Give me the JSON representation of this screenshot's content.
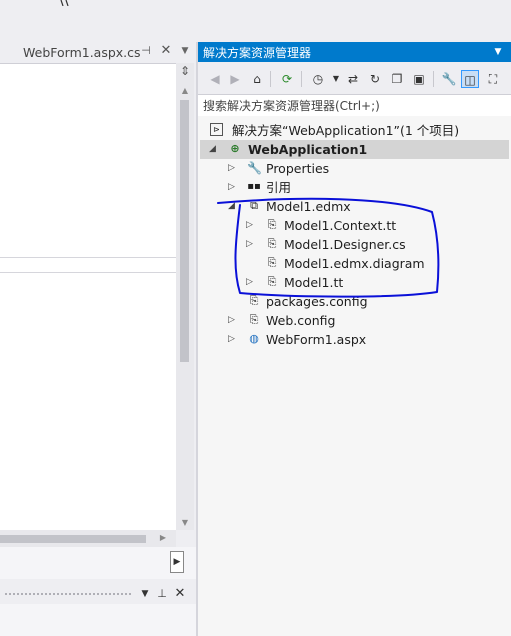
{
  "editor": {
    "tab_label": "WebForm1.aspx.cs",
    "close_glyph": "✕"
  },
  "solution_explorer": {
    "title": "解决方案资源管理器",
    "search_placeholder": "搜索解决方案资源管理器(Ctrl+;)",
    "tree": [
      {
        "label": "解决方案“WebApplication1”(1 个项目)",
        "icon": "solution-icon"
      },
      {
        "label": "WebApplication1",
        "icon": "web-project-icon",
        "bold": true,
        "selected": true
      },
      {
        "label": "Properties",
        "icon": "wrench-icon"
      },
      {
        "label": "引用",
        "icon": "references-icon"
      },
      {
        "label": "Model1.edmx",
        "icon": "edmx-icon"
      },
      {
        "label": "Model1.Context.tt",
        "icon": "tt-file-icon"
      },
      {
        "label": "Model1.Designer.cs",
        "icon": "cs-file-icon"
      },
      {
        "label": "Model1.edmx.diagram",
        "icon": "diagram-file-icon"
      },
      {
        "label": "Model1.tt",
        "icon": "tt-file-icon"
      },
      {
        "label": "packages.config",
        "icon": "config-file-icon"
      },
      {
        "label": "Web.config",
        "icon": "config-file-icon"
      },
      {
        "label": "WebForm1.aspx",
        "icon": "aspx-globe-icon"
      }
    ]
  },
  "colors": {
    "accent": "#007acc",
    "annotation": "#0a10d8"
  }
}
